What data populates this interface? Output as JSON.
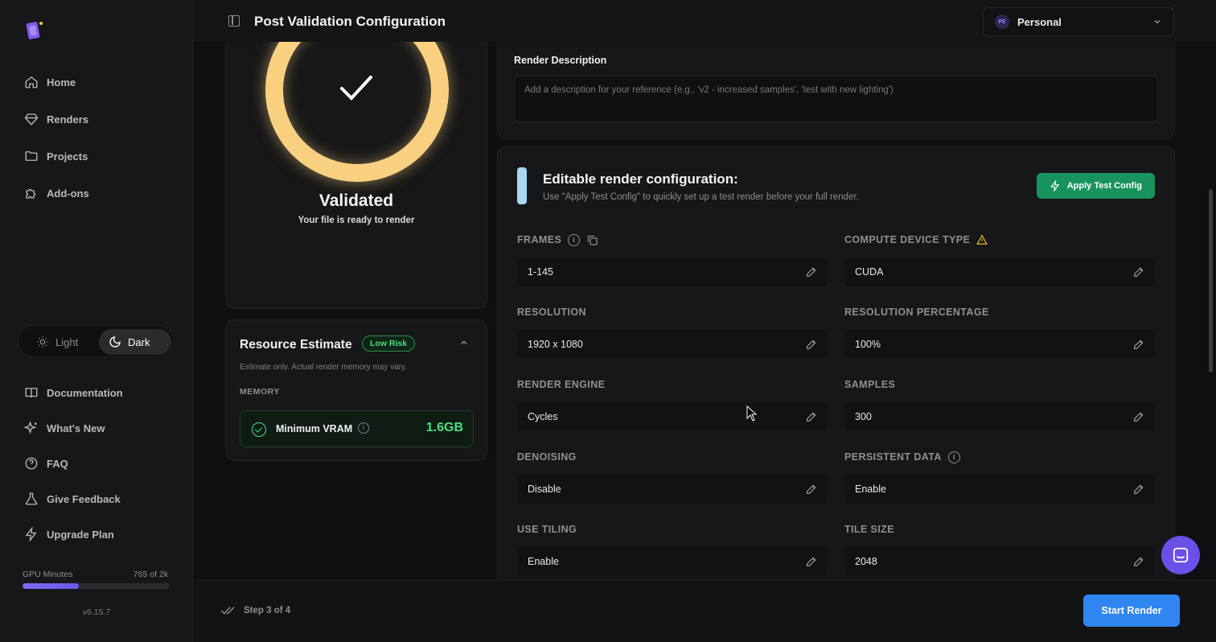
{
  "app": {
    "title": "Post Validation Configuration"
  },
  "workspace": {
    "initials": "PE",
    "name": "Personal"
  },
  "sidebar": {
    "nav": [
      {
        "label": "Home",
        "icon": "home-icon"
      },
      {
        "label": "Renders",
        "icon": "gem-icon"
      },
      {
        "label": "Projects",
        "icon": "folder-icon"
      },
      {
        "label": "Add-ons",
        "icon": "puzzle-icon"
      }
    ],
    "theme": {
      "light": "Light",
      "dark": "Dark",
      "selected": "Dark"
    },
    "secondary": [
      {
        "label": "Documentation",
        "icon": "book-icon"
      },
      {
        "label": "What's New",
        "icon": "sparkles-icon"
      },
      {
        "label": "FAQ",
        "icon": "help-circle-icon"
      },
      {
        "label": "Give Feedback",
        "icon": "flask-icon"
      },
      {
        "label": "Upgrade Plan",
        "icon": "bolt-icon"
      }
    ],
    "gpu": {
      "label": "GPU Minutes",
      "count": "765 of 2k",
      "fraction": 0.38
    },
    "version": "v6.15.7"
  },
  "validation": {
    "title": "Validated",
    "subtitle": "Your file is ready to render"
  },
  "resource": {
    "title": "Resource Estimate",
    "badge": "Low Risk",
    "note": "Estimate only. Actual render memory may vary.",
    "memory_label": "MEMORY",
    "vram_label": "Minimum VRAM",
    "vram_value": "1.6GB"
  },
  "description": {
    "label": "Render Description",
    "placeholder": "Add a description for your reference (e.g., 'v2 - increased samples', 'test with new lighting')"
  },
  "config": {
    "title": "Editable render configuration:",
    "subtitle": "Use \"Apply Test Config\" to quickly set up a test render before your full render.",
    "apply_label": "Apply Test Config",
    "fields": [
      {
        "label": "FRAMES",
        "value": "1-145"
      },
      {
        "label": "COMPUTE DEVICE TYPE",
        "value": "CUDA"
      },
      {
        "label": "RESOLUTION",
        "value": "1920 x 1080"
      },
      {
        "label": "RESOLUTION PERCENTAGE",
        "value": "100%"
      },
      {
        "label": "RENDER ENGINE",
        "value": "Cycles"
      },
      {
        "label": "SAMPLES",
        "value": "300"
      },
      {
        "label": "DENOISING",
        "value": "Disable"
      },
      {
        "label": "PERSISTENT DATA",
        "value": "Enable"
      },
      {
        "label": "USE TILING",
        "value": "Enable"
      },
      {
        "label": "TILE SIZE",
        "value": "2048"
      }
    ]
  },
  "footer": {
    "step": "Step 3 of 4",
    "start_label": "Start Render"
  },
  "colors": {
    "accent_green": "#4ade80",
    "apply_green": "#18935e",
    "primary_blue": "#2f86f0",
    "ring_yellow": "#f8d080",
    "chat_purple": "#6a4fe8"
  }
}
